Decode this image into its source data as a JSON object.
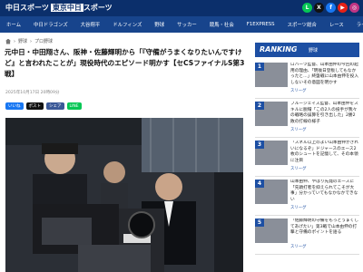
{
  "header": {
    "logo_main": "中日スポーツ",
    "logo_accent": "東京中日",
    "logo_tail": "スポーツ",
    "social": [
      {
        "name": "line-icon",
        "glyph": "L",
        "color": "#06c755"
      },
      {
        "name": "x-icon",
        "glyph": "X",
        "color": "#111111"
      },
      {
        "name": "facebook-icon",
        "glyph": "f",
        "color": "#1877f2"
      },
      {
        "name": "youtube-icon",
        "glyph": "▶",
        "color": "#e62117"
      },
      {
        "name": "instagram-icon",
        "glyph": "◎",
        "color": "#c13584"
      }
    ]
  },
  "nav": [
    "ホーム",
    "中日ドラゴンズ",
    "大谷翔平",
    "ドルフィンズ",
    "野球",
    "サッカー",
    "競馬・社会",
    "F1EXPRESS",
    "スポーツ総合",
    "レース",
    "ライフ"
  ],
  "breadcrumb": [
    "野球",
    "プロ野球"
  ],
  "article": {
    "title": "元中日・中田翔さん、阪神・佐藤輝明から「『守備がうまくなりたいんですけど』と言われたことが」現役時代のエピソード明かす【セCSファイナルS第3戦】",
    "date": "2025年10月17日 20時09分",
    "share": [
      {
        "label": "いいね",
        "color": "#1877f2"
      },
      {
        "label": "ポスト",
        "color": "#111111"
      },
      {
        "label": "シェア",
        "color": "#3b5998"
      },
      {
        "label": "LINE",
        "color": "#06c755"
      }
    ]
  },
  "ranking": {
    "title": "RANKING",
    "subtitle": "野球",
    "items": [
      {
        "num": "1",
        "text": "ロバーツ監督、山本由伸の今回の起用の理由、「明後日登板してもなかったと…」終盤戦に山本由伸を投入しないその意図を明かす",
        "cat": "スリーグ"
      },
      {
        "num": "2",
        "text": "ブルージェイズ監督、山本由伸をスキルに脱帽「この2人の投手が我々の戦略の誤算を引き出した」2勝2敗の打線の様子",
        "cat": "スリーグ"
      },
      {
        "num": "3",
        "text": "「スネル以上のよい山本由伸がきれいになるぞ」ドジャースのエース2枚のシュートを記憶して、その本領に注目",
        "cat": "スリーグ"
      },
      {
        "num": "4",
        "text": "山本由伸、やはり先発のエースに「先頭打者を抑えられてこそが大事」分かっていてもなかなかできない",
        "cat": "スリーグ"
      },
      {
        "num": "5",
        "text": "「佐藤輝明の守備をもっとうまくしてあげたい」第3戦で山本由伸の打撃と守備のポイントを語る",
        "cat": "スリーグ"
      }
    ]
  }
}
